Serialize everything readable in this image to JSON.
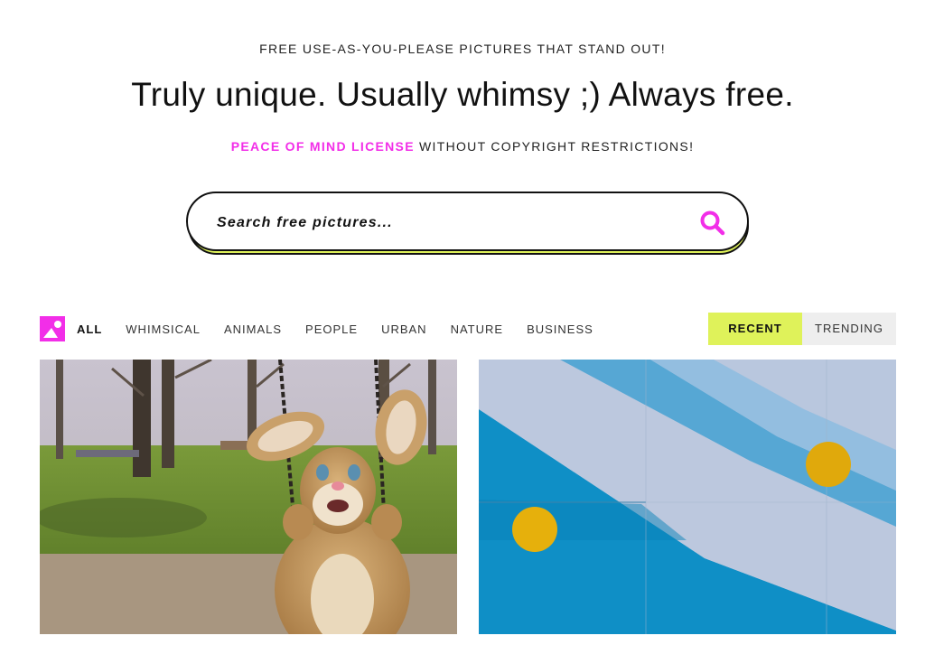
{
  "header": {
    "tagline": "FREE USE-AS-YOU-PLEASE PICTURES THAT STAND OUT!",
    "headline": "Truly unique. Usually whimsy ;) Always free.",
    "license_link": "PEACE OF MIND LICENSE",
    "license_rest": " WITHOUT COPYRIGHT RESTRICTIONS!"
  },
  "search": {
    "placeholder": "Search free pictures...",
    "icon": "search-icon"
  },
  "filters": {
    "icon": "image-icon",
    "categories": [
      "ALL",
      "WHIMSICAL",
      "ANIMALS",
      "PEOPLE",
      "URBAN",
      "NATURE",
      "BUSINESS"
    ],
    "active_category": "ALL",
    "sort": {
      "recent": "RECENT",
      "trending": "TRENDING",
      "active": "RECENT"
    }
  },
  "photos": [
    {
      "subject": "bunny-costume-on-swing"
    },
    {
      "subject": "blue-wall-yellow-circles"
    }
  ],
  "colors": {
    "accent_pink": "#f22ee8",
    "accent_lime": "#dff25a",
    "text": "#111111"
  }
}
